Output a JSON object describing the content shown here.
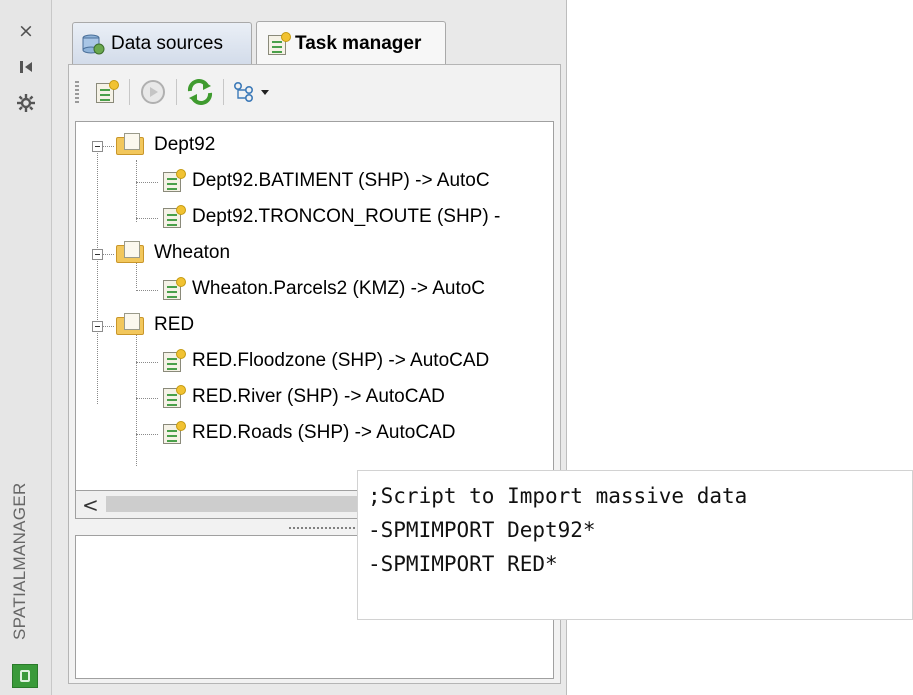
{
  "palette": {
    "close_glyph": "×",
    "title": "SPATIALMANAGER"
  },
  "tabs": [
    {
      "label": "Data sources",
      "active": false,
      "icon": "database-icon"
    },
    {
      "label": "Task manager",
      "active": true,
      "icon": "task-list-icon"
    }
  ],
  "toolbar": {
    "buttons": [
      "new-task-icon",
      "run-task-icon",
      "refresh-icon",
      "options-dropdown-icon"
    ]
  },
  "tree": {
    "groups": [
      {
        "label": "Dept92",
        "children": [
          "Dept92.BATIMENT (SHP) -> AutoC",
          "Dept92.TRONCON_ROUTE (SHP) -"
        ]
      },
      {
        "label": "Wheaton",
        "children": [
          "Wheaton.Parcels2 (KMZ) -> AutoC"
        ]
      },
      {
        "label": "RED",
        "children": [
          "RED.Floodzone (SHP) -> AutoCAD",
          "RED.River (SHP) -> AutoCAD",
          "RED.Roads (SHP) -> AutoCAD"
        ]
      }
    ]
  },
  "scrollbar": {
    "left_arrow": "<"
  },
  "script": {
    "lines": [
      ";Script to Import massive data",
      "-SPMIMPORT Dept92*",
      "-SPMIMPORT RED*"
    ]
  }
}
